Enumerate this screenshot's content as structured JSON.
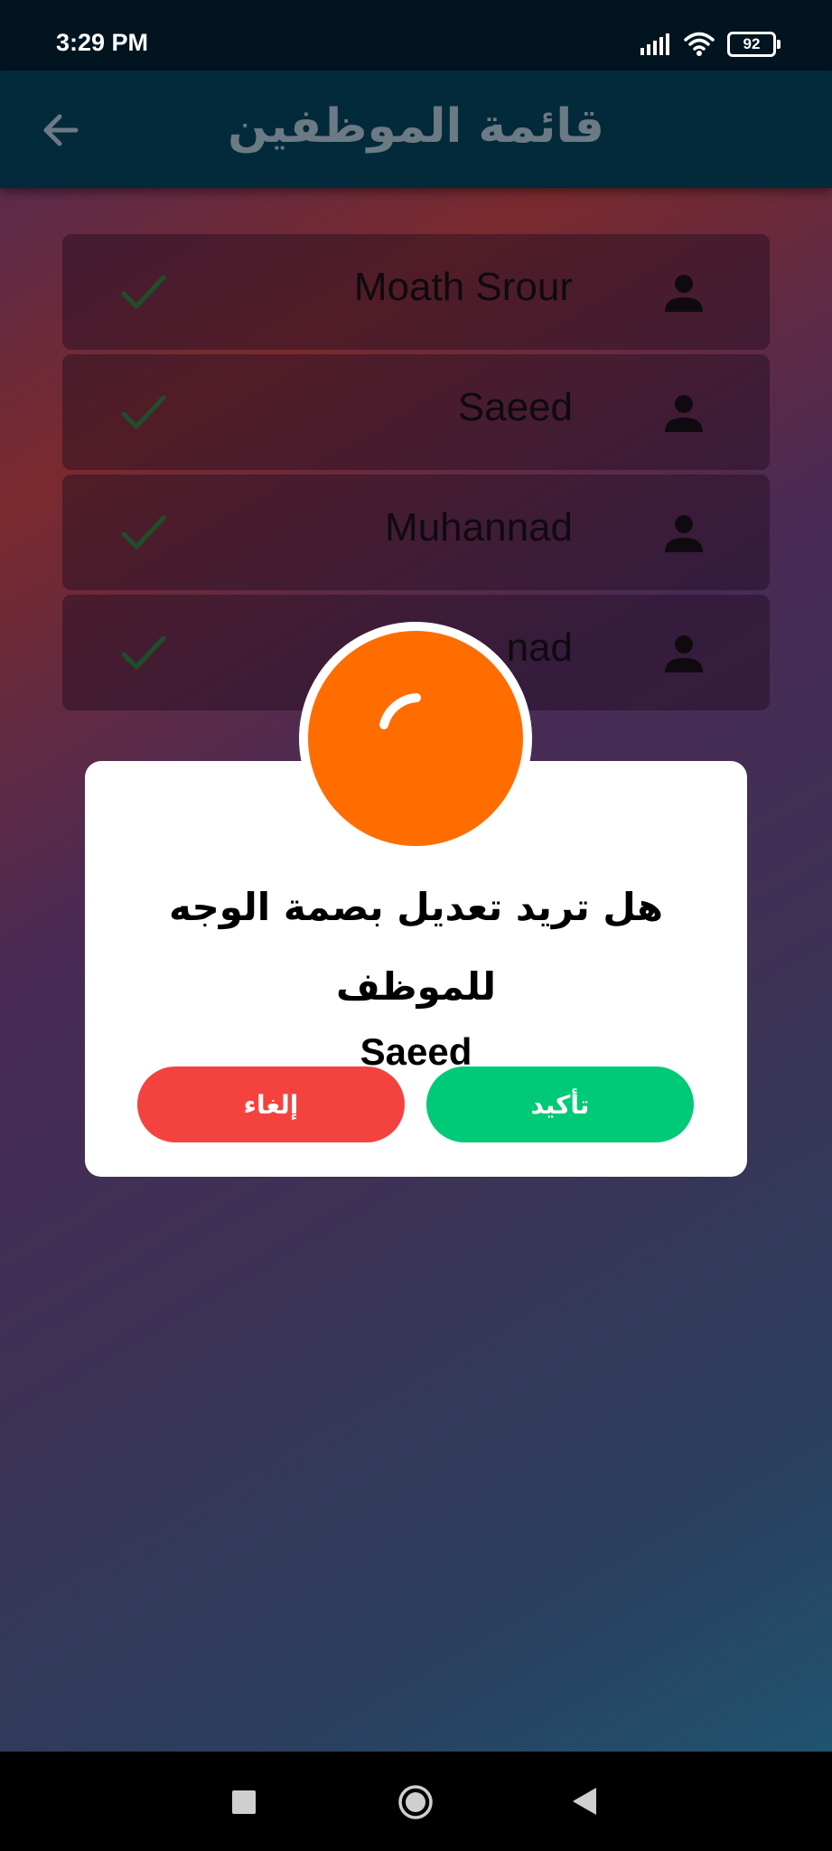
{
  "status_bar": {
    "time": "3:29 PM",
    "battery": "92"
  },
  "app_bar": {
    "title": "قائمة الموظفين"
  },
  "employees": [
    {
      "name": "Moath Srour"
    },
    {
      "name": "Saeed"
    },
    {
      "name": "Muhannad"
    },
    {
      "name": "nad"
    }
  ],
  "dialog": {
    "message_line1": "هل تريد تعديل بصمة الوجه للموظف",
    "message_line2": "Saeed",
    "confirm_label": "تأكيد",
    "cancel_label": "إلغاء"
  },
  "colors": {
    "accent_orange": "#ff6d00",
    "confirm_green": "#00c977",
    "cancel_red": "#f4433f",
    "appbar": "#022a3a"
  },
  "icons": {
    "back": "arrow-left-icon",
    "check": "check-icon",
    "person": "person-icon",
    "dialog": "loading-spinner-icon"
  }
}
